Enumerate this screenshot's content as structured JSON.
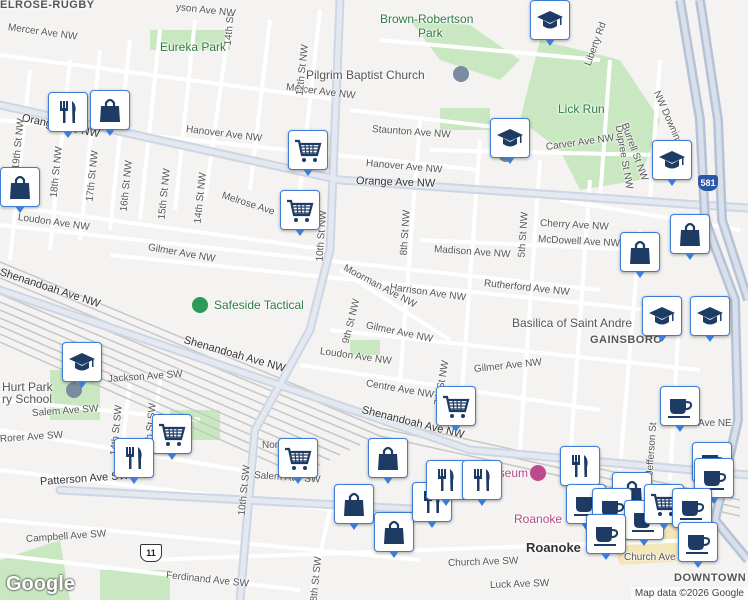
{
  "colors": {
    "marker_border": "#3c7dd8",
    "marker_icon": "#1e3b64",
    "road_major": "#cdd6e3",
    "road_minor": "#ffffff",
    "rail": "#c7c7c7",
    "park": "#c9e8c1",
    "land": "#f4f3f1"
  },
  "labels": {
    "melrose_rugby": "ELROSE-RUGBY",
    "gainsboro": "GAINSBORO",
    "downtown": "DOWNTOWN",
    "eureka_park": "Eureka Park",
    "brown_robertson": "Brown-Robertson",
    "brown_robertson_park": "Park",
    "pilgrim_baptist": "Pilgrim Baptist Church",
    "lick_run": "Lick Run",
    "safeside_tactical": "Safeside Tactical",
    "basilica": "Basilica of Saint Andre",
    "hurt_park": "Hurt Park",
    "ry_school": "ry School",
    "museum": "Museum",
    "roanoke_small": "Roanoke",
    "roanoke_city": "Roanoke",
    "mercer_ave_nw_1": "Mercer Ave NW",
    "mercer_ave_nw_2": "Mercer Ave NW",
    "hanover_ave_nw_1": "Hanover Ave NW",
    "hanover_ave_nw_2": "Hanover Ave NW",
    "staunton_ave_nw": "Staunton Ave NW",
    "carver_ave_nw": "Carver Ave NW",
    "orange_ave_nw_1": "Orange Ave NW",
    "orange_ave_nw_2": "Orange Ave NW",
    "melrose_ave": "Melrose Ave",
    "loudon_ave_nw_1": "Loudon Ave NW",
    "loudon_ave_nw_2": "Loudon Ave NW",
    "gilmer_ave_nw_1": "Gilmer Ave NW",
    "gilmer_ave_nw_2": "Gilmer Ave NW",
    "gilmer_ave_nw_3": "Gilmer Ave NW",
    "madison_ave_nw": "Madison Ave NW",
    "cherry_ave_nw": "Cherry Ave NW",
    "mcdowell_ave_nw": "McDowell Ave NW",
    "rutherford_ave_nw": "Rutherford Ave NW",
    "harrison_ave_nw": "Harrison Ave NW",
    "moorman_ave_nw": "Moorman Ave NW",
    "centre_ave_nw": "Centre Ave NW",
    "shenandoah_ave_nw_1": "Shenandoah Ave NW",
    "shenandoah_ave_nw_2": "Shenandoah Ave NW",
    "shenandoah_ave_nw_3": "Shenandoah Ave NW",
    "jackson_ave_sw": "Jackson Ave SW",
    "salem_ave_sw_1": "Salem Ave SW",
    "salem_ave_sw_2": "Salem Ave SW",
    "rorer_ave_sw": "Rorer Ave SW",
    "patterson_ave_sw": "Patterson Ave SW",
    "campbell_ave_sw": "Campbell Ave SW",
    "ferdinand_ave_sw": "Ferdinand Ave SW",
    "church_ave_sw": "Church Ave SW",
    "luck_ave_sw": "Luck Ave SW",
    "church_ave": "Church Ave",
    "norfolk_ave": "Nor",
    "ave_ne": "Ave NE",
    "st_10th_nw": "10th St NW",
    "st_12th_nw": "12th St NW",
    "st_14th": "14th St",
    "st_14th_nw": "14th St NW",
    "st_15th_nw": "15th St NW",
    "st_16th_nw": "16th St NW",
    "st_17th_nw": "17th St NW",
    "st_18th_nw": "18th St NW",
    "st_19th_nw": "19th St NW",
    "st_8th_nw": "8th St NW",
    "st_9th_nw": "9th St NW",
    "st_7th": "7th St NW",
    "st_5th_nw": "5th St NW",
    "st_10th_sw": "10th St SW",
    "st_14th_sw": "14th St SW",
    "st_13th_sw": "13th St SW",
    "st_8th_sw": "8th St SW",
    "liberty_rd": "Liberty Rd",
    "dupree_st": "Dupree St NW",
    "burrell_st": "Burrell St NW",
    "nw_downing": "NW Downing S",
    "jefferson_st": "Jefferson St",
    "dayson": "yson Ave NW",
    "route_581": "581",
    "route_11": "11",
    "google": "Google",
    "attribution": "Map data ©2026 Google"
  },
  "markers": [
    {
      "kind": "restaurant",
      "name": "restaurant-marker"
    },
    {
      "kind": "shopping",
      "name": "shopping-marker"
    },
    {
      "kind": "grocery",
      "name": "grocery-marker"
    },
    {
      "kind": "grocery",
      "name": "grocery-marker"
    },
    {
      "kind": "school",
      "name": "school-marker"
    },
    {
      "kind": "school",
      "name": "school-marker"
    },
    {
      "kind": "school",
      "name": "school-marker"
    },
    {
      "kind": "shopping",
      "name": "shopping-marker"
    },
    {
      "kind": "shopping",
      "name": "shopping-marker"
    },
    {
      "kind": "shopping",
      "name": "shopping-marker"
    },
    {
      "kind": "school",
      "name": "school-marker"
    },
    {
      "kind": "school",
      "name": "school-marker"
    },
    {
      "kind": "school",
      "name": "school-marker"
    },
    {
      "kind": "grocery",
      "name": "grocery-marker"
    },
    {
      "kind": "cafe",
      "name": "cafe-marker"
    },
    {
      "kind": "grocery",
      "name": "grocery-marker"
    },
    {
      "kind": "restaurant",
      "name": "restaurant-marker"
    },
    {
      "kind": "grocery",
      "name": "grocery-marker"
    },
    {
      "kind": "shopping",
      "name": "shopping-marker"
    },
    {
      "kind": "shopping",
      "name": "shopping-marker"
    },
    {
      "kind": "shopping",
      "name": "shopping-marker"
    },
    {
      "kind": "restaurant",
      "name": "restaurant-marker"
    },
    {
      "kind": "restaurant",
      "name": "restaurant-marker"
    },
    {
      "kind": "restaurant",
      "name": "restaurant-marker"
    },
    {
      "kind": "restaurant",
      "name": "restaurant-marker"
    },
    {
      "kind": "cafe",
      "name": "cafe-marker"
    },
    {
      "kind": "cafe",
      "name": "cafe-marker"
    },
    {
      "kind": "shopping",
      "name": "shopping-marker"
    },
    {
      "kind": "cafe",
      "name": "cafe-marker"
    },
    {
      "kind": "cafe",
      "name": "cafe-marker"
    },
    {
      "kind": "cafe",
      "name": "cafe-marker"
    },
    {
      "kind": "grocery",
      "name": "grocery-marker"
    },
    {
      "kind": "cafe",
      "name": "cafe-marker"
    },
    {
      "kind": "cafe",
      "name": "cafe-marker"
    },
    {
      "kind": "cafe",
      "name": "cafe-marker"
    }
  ]
}
